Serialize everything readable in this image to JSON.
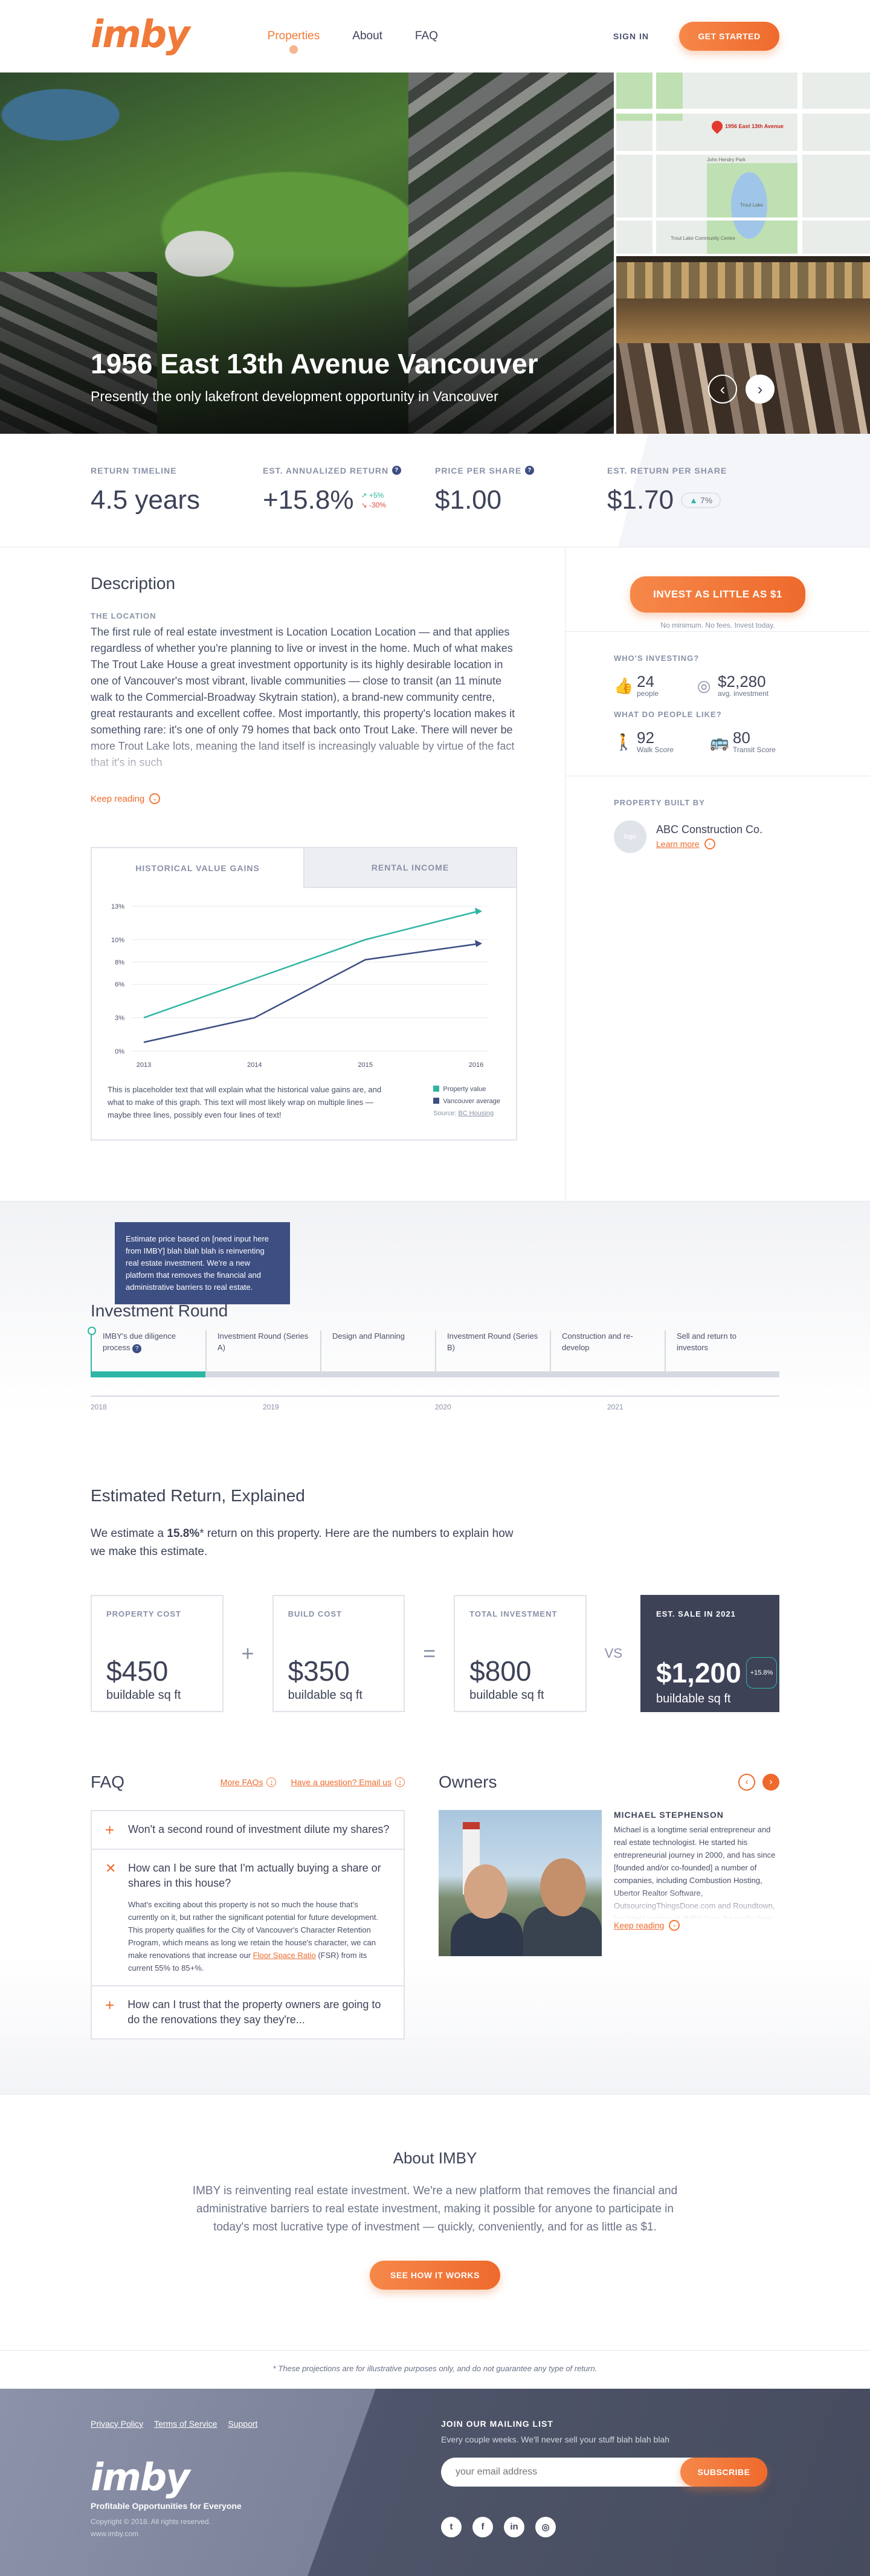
{
  "header": {
    "logo": "imby",
    "nav": [
      "Properties",
      "About",
      "FAQ"
    ],
    "sign_in": "SIGN IN",
    "get_started": "GET STARTED"
  },
  "hero": {
    "title": "1956 East 13th Avenue Vancouver",
    "subtitle": "Presently the only lakefront development opportunity in Vancouver",
    "map_pin_label": "1956 East 13th Avenue",
    "map_labels": [
      "Trout Lake",
      "John Hendry Park",
      "Trout Lake Community Centre"
    ],
    "prev_icon": "chevron-left-icon",
    "next_icon": "chevron-right-icon"
  },
  "stats": {
    "return_timeline": {
      "label": "RETURN TIMELINE",
      "value": "4.5 years"
    },
    "annualized": {
      "label": "EST. ANNUALIZED RETURN",
      "value": "+15.8%",
      "up": "+5%",
      "down": "-30%"
    },
    "price": {
      "label": "PRICE PER SHARE",
      "value": "$1.00"
    },
    "per_share": {
      "label": "EST. RETURN PER SHARE",
      "value": "$1.70",
      "badge": "7%"
    }
  },
  "description": {
    "heading": "Description",
    "label": "THE LOCATION",
    "text": "The first rule of real estate investment is Location Location Location — and that applies regardless of whether you're planning to live or invest in the home. Much of what makes The Trout Lake House a great investment opportunity is its highly desirable location in one of Vancouver's most vibrant, livable communities — close to transit (an 11 minute walk to the Commercial-Broadway Skytrain station), a brand-new community centre, great restaurants and excellent coffee. Most importantly, this property's location makes it something rare: it's one of only 79 homes that back onto Trout Lake. There will never be more Trout Lake lots, meaning the land itself is increasingly valuable by virtue of the fact that it's in such",
    "keep_reading": "Keep reading"
  },
  "chart_tabs": [
    "HISTORICAL VALUE GAINS",
    "RENTAL INCOME"
  ],
  "chart_data": {
    "type": "line",
    "x": [
      2013,
      2014,
      2015,
      2016
    ],
    "yticks": [
      "0%",
      "3%",
      "6%",
      "8%",
      "10%",
      "13%"
    ],
    "ylim": [
      0,
      13
    ],
    "series": [
      {
        "name": "Property value",
        "color": "#2fb5a4",
        "values": [
          3.0,
          6.5,
          10.0,
          12.5
        ]
      },
      {
        "name": "Vancouver average",
        "color": "#3d4e82",
        "values": [
          0.8,
          3.0,
          8.2,
          9.6
        ]
      }
    ],
    "note": "This is placeholder text that will explain what the historical value gains are, and what to make of this graph. This text will most likely wrap on multiple lines — maybe three lines, possibly even four lines of text!",
    "source_prefix": "Source: ",
    "source_link": "BC Housing"
  },
  "sidebar": {
    "invest_button": "INVEST AS LITTLE AS $1",
    "invest_note": "No minimum. No fees. Invest today.",
    "whos_investing": "WHO'S INVESTING?",
    "people_num": "24",
    "people_label": "people",
    "avg_num": "$2,280",
    "avg_label": "avg. investment",
    "what_like": "WHAT DO PEOPLE LIKE?",
    "walk_num": "92",
    "walk_label": "Walk Score",
    "transit_num": "80",
    "transit_label": "Transit Score",
    "built_by": "PROPERTY BUILT BY",
    "builder_logo": "logo",
    "builder_name": "ABC Construction Co.",
    "learn_more": "Learn more"
  },
  "timeline": {
    "title": "Investment Round",
    "tooltip": "Estimate price based on [need input here from IMBY] blah blah blah is reinventing real estate investment. We're a new platform that removes the financial and administrative barriers to real estate.",
    "steps": [
      "IMBY's due diligence process",
      "Investment Round (Series A)",
      "Design and Planning",
      "Investment Round (Series B)",
      "Construction and re-develop",
      "Sell and return to investors"
    ],
    "years": [
      "2018",
      "2019",
      "2020",
      "2021"
    ]
  },
  "estimated": {
    "title": "Estimated Return, Explained",
    "intro_a": "We estimate a ",
    "intro_b": "15.8%",
    "intro_c": "* return on this property. Here are the numbers to explain how we make this estimate.",
    "cards": [
      {
        "label": "PROPERTY COST",
        "value": "$450",
        "unit": "buildable sq ft"
      },
      {
        "label": "BUILD COST",
        "value": "$350",
        "unit": "buildable sq ft"
      },
      {
        "label": "TOTAL INVESTMENT",
        "value": "$800",
        "unit": "buildable sq ft"
      },
      {
        "label": "EST. SALE IN 2021",
        "value": "$1,200",
        "unit": "buildable sq ft",
        "badge": "+15.8%"
      }
    ],
    "ops": [
      "+",
      "=",
      "VS"
    ]
  },
  "faq": {
    "title": "FAQ",
    "more": "More FAQs",
    "question": "Have a question? Email us",
    "items": [
      {
        "q": "Won't a second round of investment dilute my shares?"
      },
      {
        "q": "How can I be sure that I'm actually buying a share or shares in this house?",
        "a1": "What's exciting about this property is not so much the house that's currently on it, but rather the significant potential for future development. This property qualifies for the City of Vancouver's Character Retention Program, which means as long we retain the house's character, we can make renovations that increase our ",
        "a_link": "Floor Space Ratio",
        "a2": " (FSR) from its current 55% to 85+%."
      },
      {
        "q": "How can I trust that the property owners are going to do the renovations they say they're..."
      }
    ]
  },
  "owners": {
    "title": "Owners",
    "name": "MICHAEL STEPHENSON",
    "bio": "Michael is a longtime serial entrepreneur and real estate technologist. He started his entrepreneurial journey in 2000, and has since [founded and/or co-founded] a number of companies, including Combustion Hosting, Ubertor Realtor Software, OutsourcingThingsDone.com and Roundtown, his latest venture is IMBY (yes, he really does love real estate).",
    "keep_reading": "Keep reading"
  },
  "about": {
    "title": "About IMBY",
    "text": "IMBY is reinventing real estate investment. We're a new platform that removes the financial and administrative barriers to real estate investment, making it possible for anyone to participate in today's most lucrative type of investment — quickly, conveniently, and for as little as $1.",
    "button": "SEE HOW IT WORKS"
  },
  "disclaimer": "* These projections are for illustrative purposes only, and do not guarantee any type of return.",
  "footer": {
    "links": [
      "Privacy Policy",
      "Terms of Service",
      "Support"
    ],
    "logo": "imby",
    "tagline": "Profitable Opportunities for Everyone",
    "copyright": "Copyright © 2018. All rights reserved.",
    "site": "www.imby.com",
    "mail_title": "JOIN OUR MAILING LIST",
    "mail_sub": "Every couple weeks. We'll never sell your stuff blah blah blah",
    "email_placeholder": "your email address",
    "subscribe": "SUBSCRIBE",
    "socials": [
      "twitter-icon",
      "facebook-icon",
      "linkedin-icon",
      "instagram-icon"
    ]
  }
}
